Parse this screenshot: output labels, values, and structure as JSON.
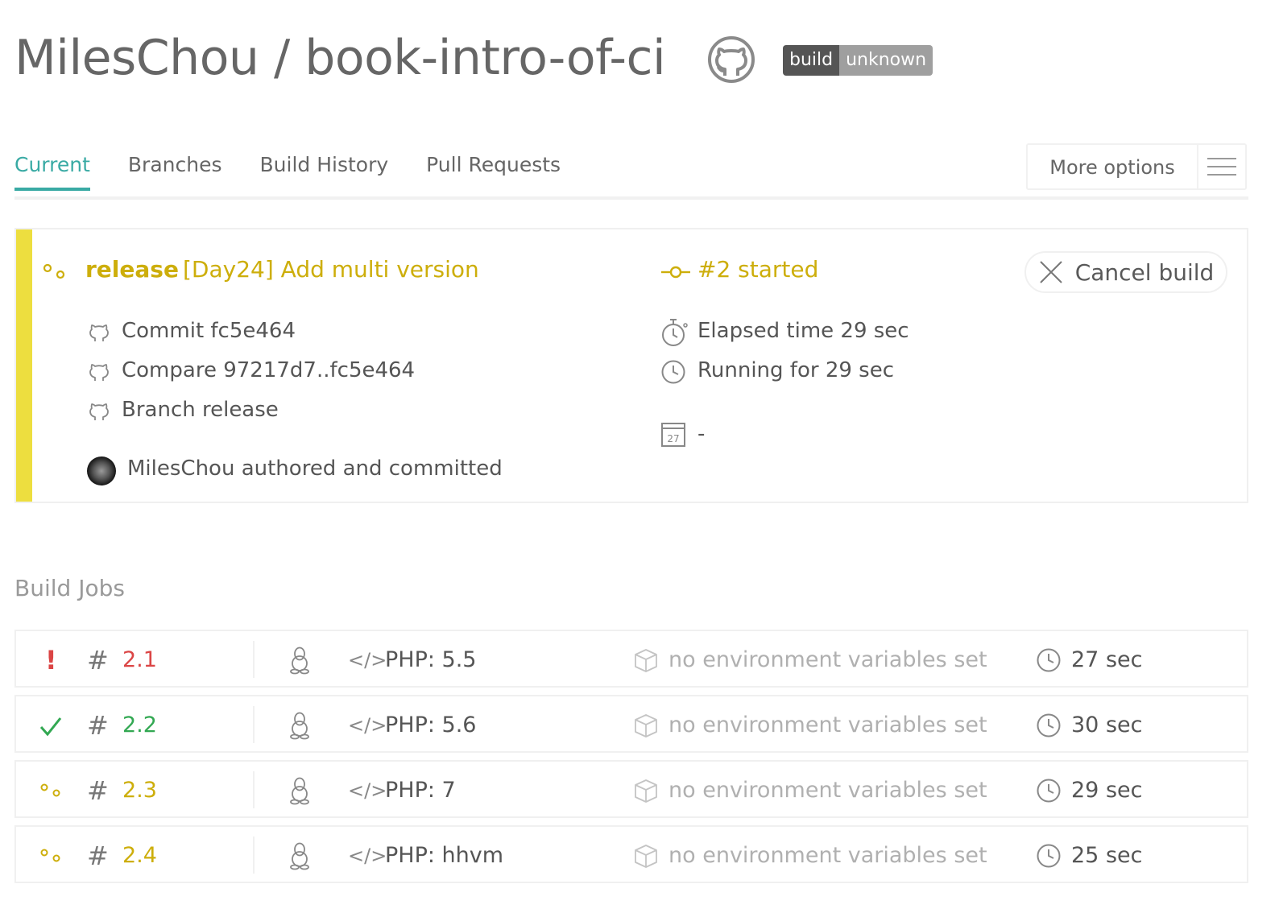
{
  "header": {
    "title": "MilesChou / book-intro-of-ci",
    "badge_left": "build",
    "badge_right": "unknown"
  },
  "tabs": [
    {
      "label": "Current",
      "active": true
    },
    {
      "label": "Branches",
      "active": false
    },
    {
      "label": "Build History",
      "active": false
    },
    {
      "label": "Pull Requests",
      "active": false
    }
  ],
  "more_options": "More options",
  "build": {
    "branch": "release",
    "message": "[Day24] Add multi version",
    "number_status": "#2 started",
    "cancel_label": "Cancel build",
    "commit": "Commit fc5e464",
    "compare": "Compare 97217d7..fc5e464",
    "branch_line": "Branch release",
    "author": "MilesChou authored and committed",
    "elapsed": "Elapsed time 29 sec",
    "running": "Running for 29 sec",
    "calendar_day": "27",
    "date": "-",
    "status_color": "#edde3f"
  },
  "build_jobs": {
    "title": "Build Jobs",
    "jobs": [
      {
        "status": "failed",
        "number": "2.1",
        "language": "PHP: 5.5",
        "env": "no environment variables set",
        "duration": "27 sec"
      },
      {
        "status": "passed",
        "number": "2.2",
        "language": "PHP: 5.6",
        "env": "no environment variables set",
        "duration": "30 sec"
      },
      {
        "status": "running",
        "number": "2.3",
        "language": "PHP: 7",
        "env": "no environment variables set",
        "duration": "29 sec"
      },
      {
        "status": "running",
        "number": "2.4",
        "language": "PHP: hhvm",
        "env": "no environment variables set",
        "duration": "25 sec"
      }
    ]
  },
  "colors": {
    "accent": "#39aaa4",
    "running": "#cdae0b",
    "failed": "#db4545",
    "passed": "#32a852"
  },
  "icons": {
    "repo": "github-icon",
    "status_running": "dots-icon",
    "commit": "github-icon",
    "number": "commit-icon",
    "elapsed": "stopwatch-icon",
    "running": "clock-icon",
    "date": "calendar-icon",
    "cancel": "close-icon",
    "os": "linux-icon",
    "language": "code-icon",
    "env": "box-icon",
    "duration": "clock-icon"
  }
}
